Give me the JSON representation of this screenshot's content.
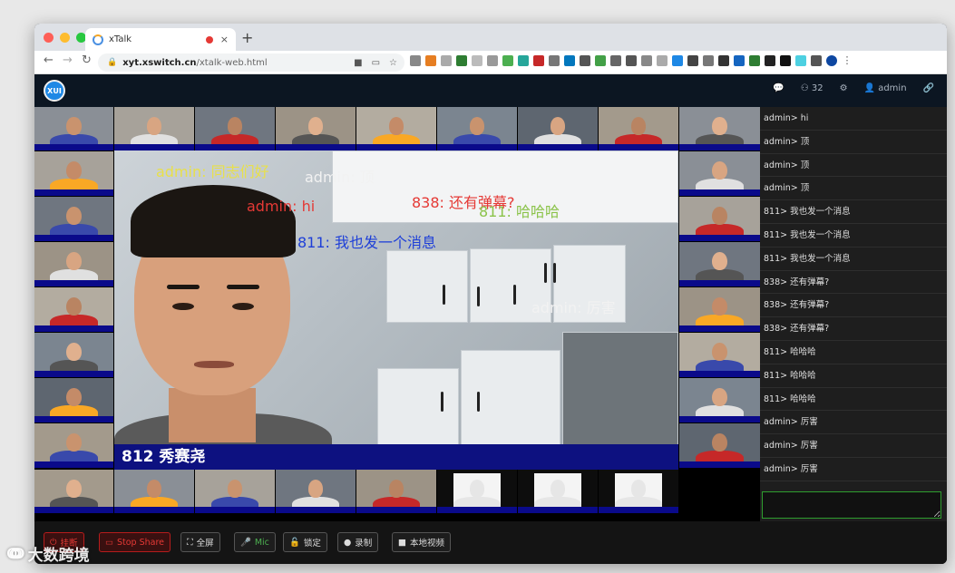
{
  "browser": {
    "tab_title": "xTalk",
    "tab_close": "×",
    "new_tab": "+",
    "url_host": "xyt.xswitch.cn",
    "url_path": "/xtalk-web.html"
  },
  "app": {
    "logo_text": "XUI",
    "participant_count": "32",
    "user_name": "admin"
  },
  "main_video": {
    "name_label": "812 秀赛尧"
  },
  "danmaku": [
    {
      "text": "admin: 同志们好",
      "color": "#e8e04a"
    },
    {
      "text": "admin: 顶",
      "color": "#f2f2f2"
    },
    {
      "text": "838: 还有弹幕?",
      "color": "#e53935"
    },
    {
      "text": "811: 哈哈哈",
      "color": "#8bc34a"
    },
    {
      "text": "admin: hi",
      "color": "#e53935"
    },
    {
      "text": "811: 我也发一个消息",
      "color": "#1e3fd8"
    },
    {
      "text": "admin: 厉害",
      "color": "#f2f2f2"
    }
  ],
  "chat": {
    "messages": [
      "admin> hi",
      "admin> 顶",
      "admin> 顶",
      "admin> 顶",
      "811> 我也发一个消息",
      "811> 我也发一个消息",
      "811> 我也发一个消息",
      "838> 还有弹幕?",
      "838> 还有弹幕?",
      "838> 还有弹幕?",
      "811> 哈哈哈",
      "811> 哈哈哈",
      "811> 哈哈哈",
      "admin> 厉害",
      "admin> 厉害",
      "admin> 厉害"
    ],
    "input_value": ""
  },
  "controls": {
    "hangup": "挂断",
    "stop_share": "Stop Share",
    "fullscreen": "全屏",
    "mic": "Mic",
    "lock": "锁定",
    "record": "录制",
    "local_video": "本地视频"
  },
  "watermark": "大数跨境",
  "colors": {
    "accent_green": "#2e9e2e",
    "name_bar": "#0d1180",
    "danger": "#e53935"
  }
}
